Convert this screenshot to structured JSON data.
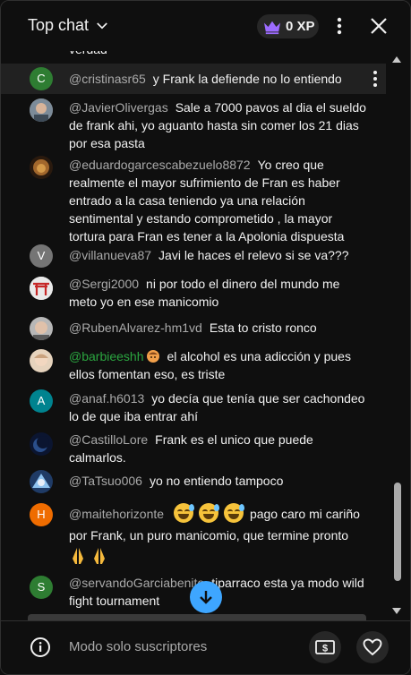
{
  "header": {
    "title": "Top chat",
    "xp_label": "0 XP"
  },
  "cutoff_text": "verdad",
  "messages": [
    {
      "user": "@cristinasr65",
      "text": "y Frank la defiende no lo entiendo",
      "avatar_letter": "C",
      "avatar_color": "#2e7d32"
    },
    {
      "user": "@JavierOlivergas",
      "text": "Sale a 7000 pavos al dia el sueldo de frank ahi, yo aguanto hasta sin comer los 21 dias por esa pasta",
      "avatar_icon": "person-photo-icon"
    },
    {
      "user": "@eduardogarcescabezuelo8872",
      "text": "Yo creo que realmente el mayor sufrimiento de Fran es haber entrado a la casa teniendo ya una relación sentimental y estando comprometido , la mayor tortura para Fran es tener a la Apolonia dispuesta",
      "avatar_icon": "lion-photo-icon"
    },
    {
      "user": "@villanueva87",
      "text": "Javi le haces el relevo si se va???",
      "avatar_letter": "V",
      "avatar_color": "#757575"
    },
    {
      "user": "@Sergi2000",
      "text": "ni por todo el dinero del mundo me meto yo en ese manicomio",
      "avatar_icon": "torii-icon"
    },
    {
      "user": "@RubenAlvarez-hm1vd",
      "text": "Esta to cristo ronco",
      "avatar_icon": "face-photo-icon"
    },
    {
      "user": "@barbieeshh",
      "text": "el alcohol es una adicción y pues ellos fomentan eso, es triste",
      "avatar_icon": "portrait-photo-icon"
    },
    {
      "user": "@anaf.h6013",
      "text": "yo decía que tenía que ser cachondeo lo de que iba entrar ahí",
      "avatar_letter": "A",
      "avatar_color": "#00838f"
    },
    {
      "user": "@CastilloLore",
      "text": "Frank es el unico que puede calmarlos.",
      "avatar_icon": "moon-photo-icon"
    },
    {
      "user": "@TaTsuo006",
      "text": "yo no entiendo tampoco",
      "avatar_icon": "anime-photo-icon"
    },
    {
      "user": "@maitehorizonte",
      "text_a": "pago caro mi cariño por Frank, un puro manicomio, que termine",
      "text_b": "pronto",
      "avatar_letter": "H",
      "avatar_color": "#ef6c00"
    },
    {
      "user": "@servandoGarciabenito",
      "text": "tiparraco esta ya modo wild fight tournament",
      "avatar_letter": "S",
      "avatar_color": "#2e7d32"
    }
  ],
  "footer": {
    "subscribers_only": "Modo solo suscriptores"
  },
  "colors": {
    "background": "#0f0f0f",
    "accent": "#3ea6ff",
    "member_name": "#2ba640",
    "xp_crown": "#9c6bff"
  }
}
